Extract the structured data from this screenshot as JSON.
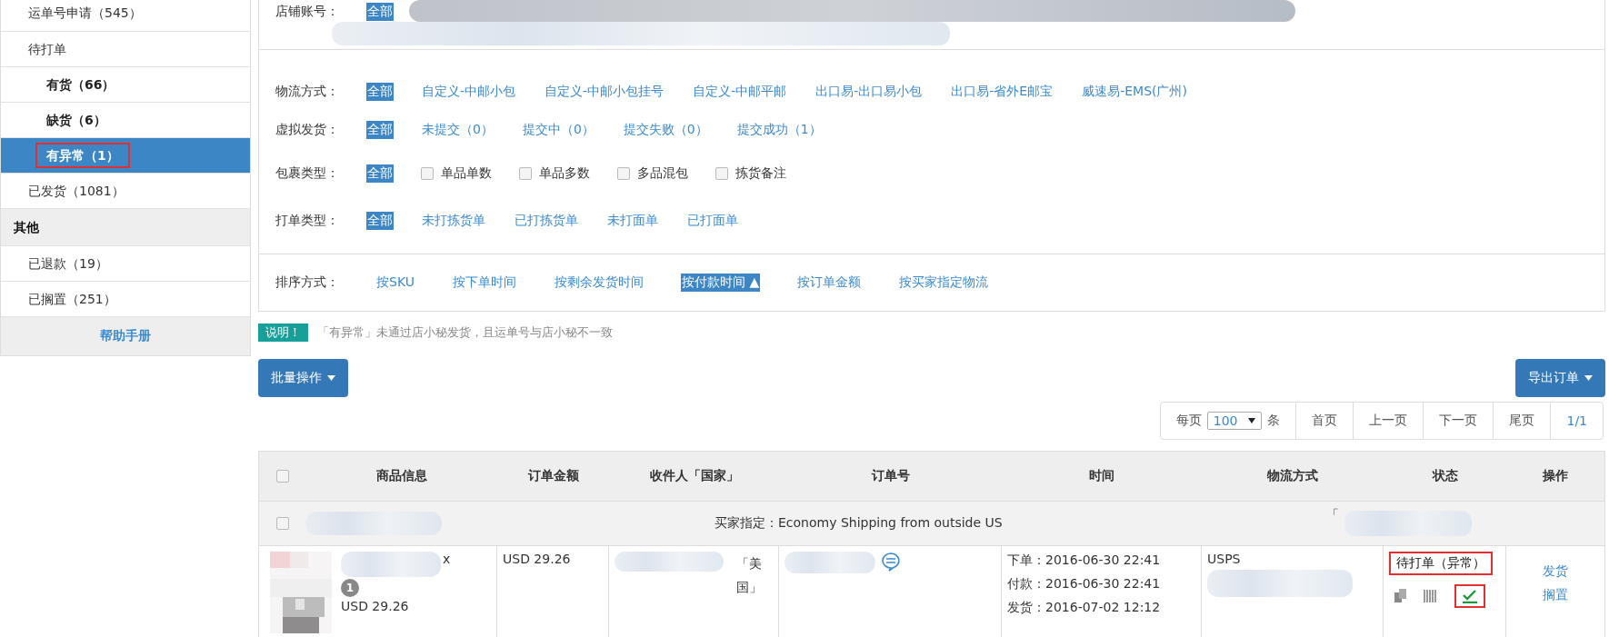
{
  "sidebar": {
    "items": [
      {
        "kind": "item",
        "label": "运单号申请（545）",
        "selected": false
      },
      {
        "kind": "item",
        "label": "待打单",
        "selected": false,
        "children": [
          {
            "label": "有货（66）",
            "selected": false,
            "highlighted": false
          },
          {
            "label": "缺货（6）",
            "selected": false,
            "highlighted": false
          },
          {
            "label": "有异常（1）",
            "selected": true,
            "highlighted": true
          }
        ]
      },
      {
        "kind": "item",
        "label": "已发货（1081）",
        "selected": false
      },
      {
        "kind": "header",
        "label": "其他"
      },
      {
        "kind": "item",
        "label": "已退款（19）",
        "selected": false
      },
      {
        "kind": "item",
        "label": "已搁置（251）",
        "selected": false
      },
      {
        "kind": "link",
        "label": "帮助手册"
      }
    ]
  },
  "store_filter": {
    "label": "店铺账号：",
    "options": [
      {
        "kind": "link",
        "label": "全部",
        "selected": true
      }
    ]
  },
  "filter_rows": [
    {
      "label": "物流方式：",
      "options": [
        {
          "kind": "link",
          "label": "全部",
          "selected": true
        },
        {
          "kind": "link",
          "label": "自定义-中邮小包",
          "selected": false
        },
        {
          "kind": "link",
          "label": "自定义-中邮小包挂号",
          "selected": false
        },
        {
          "kind": "link",
          "label": "自定义-中邮平邮",
          "selected": false
        },
        {
          "kind": "link",
          "label": "出口易-出口易小包",
          "selected": false
        },
        {
          "kind": "link",
          "label": "出口易-省外E邮宝",
          "selected": false
        },
        {
          "kind": "link",
          "label": "威速易-EMS(广州)",
          "selected": false
        }
      ]
    },
    {
      "label": "虚拟发货：",
      "options": [
        {
          "kind": "link",
          "label": "全部",
          "selected": true
        },
        {
          "kind": "link",
          "label": "未提交（0）",
          "selected": false
        },
        {
          "kind": "link",
          "label": "提交中（0）",
          "selected": false
        },
        {
          "kind": "link",
          "label": "提交失败（0）",
          "selected": false
        },
        {
          "kind": "link",
          "label": "提交成功（1）",
          "selected": false
        }
      ]
    },
    {
      "label": "包裹类型：",
      "options": [
        {
          "kind": "link",
          "label": "全部",
          "selected": true
        },
        {
          "kind": "checkbox",
          "label": "单品单数",
          "checked": false
        },
        {
          "kind": "checkbox",
          "label": "单品多数",
          "checked": false
        },
        {
          "kind": "checkbox",
          "label": "多品混包",
          "checked": false
        },
        {
          "kind": "checkbox",
          "label": "拣货备注",
          "checked": false
        }
      ]
    },
    {
      "label": "打单类型：",
      "options": [
        {
          "kind": "link",
          "label": "全部",
          "selected": true
        },
        {
          "kind": "link",
          "label": "未打拣货单",
          "selected": false
        },
        {
          "kind": "link",
          "label": "已打拣货单",
          "selected": false
        },
        {
          "kind": "link",
          "label": "未打面单",
          "selected": false
        },
        {
          "kind": "link",
          "label": "已打面单",
          "selected": false
        }
      ]
    }
  ],
  "sort_row": {
    "label": "排序方式：",
    "options": [
      {
        "label": "按SKU",
        "selected": false
      },
      {
        "label": "按下单时间",
        "selected": false
      },
      {
        "label": "按剩余发货时间",
        "selected": false
      },
      {
        "label": "按付款时间",
        "selected": true,
        "arrow": "▲"
      },
      {
        "label": "按订单金额",
        "selected": false
      },
      {
        "label": "按买家指定物流",
        "selected": false
      }
    ]
  },
  "note": {
    "badge": "说明！",
    "text": "「有异常」未通过店小秘发货，且运单号与店小秘不一致"
  },
  "batch_button": {
    "label": "批量操作"
  },
  "export_button": {
    "label": "导出订单"
  },
  "pagination": {
    "per_page_label": "每页",
    "per_page": "100",
    "unit": "条",
    "buttons": [
      "首页",
      "上一页",
      "下一页",
      "尾页"
    ],
    "page": "1/1"
  },
  "table": {
    "columns": [
      {
        "kind": "checkbox",
        "checked": false
      },
      {
        "kind": "text",
        "label": "商品信息"
      },
      {
        "kind": "text",
        "label": "订单金额"
      },
      {
        "kind": "text",
        "label": "收件人「国家」"
      },
      {
        "kind": "text",
        "label": "订单号"
      },
      {
        "kind": "text",
        "label": "时间"
      },
      {
        "kind": "text",
        "label": "物流方式"
      },
      {
        "kind": "text",
        "label": "状态"
      },
      {
        "kind": "text",
        "label": "操作"
      }
    ],
    "group_row": {
      "checked": false,
      "buyer_note": "买家指定：Economy Shipping from outside US",
      "mark": "「"
    },
    "rows": [
      {
        "quantity_mark": "x",
        "quantity": "1",
        "price": "USD 29.26",
        "amount": "USD 29.26",
        "country": "「美国」",
        "times": [
          "下单：2016-06-30 22:41",
          "付款：2016-06-30 22:41",
          "发货：2016-07-02 12:12"
        ],
        "shipping": "USPS",
        "status": "待打单（异常）",
        "status_highlighted": true,
        "done_highlighted": true,
        "actions": [
          "发货",
          "搁置"
        ]
      }
    ]
  }
}
